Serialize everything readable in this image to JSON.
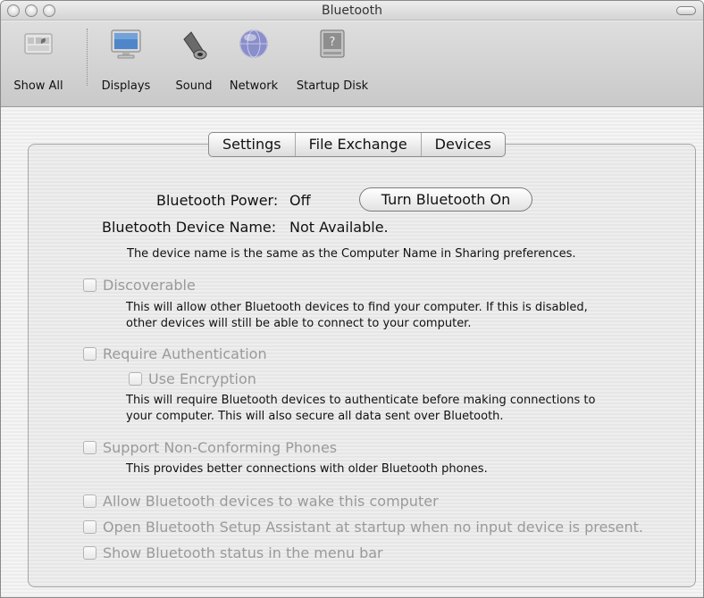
{
  "window": {
    "title": "Bluetooth"
  },
  "toolbar": {
    "items": [
      {
        "label": "Show All",
        "icon": "show-all-icon"
      },
      {
        "label": "Displays",
        "icon": "displays-icon"
      },
      {
        "label": "Sound",
        "icon": "sound-icon"
      },
      {
        "label": "Network",
        "icon": "network-icon"
      },
      {
        "label": "Startup Disk",
        "icon": "startup-disk-icon"
      }
    ]
  },
  "tabs": [
    "Settings",
    "File Exchange",
    "Devices"
  ],
  "settings": {
    "power_label": "Bluetooth Power:",
    "power_value": "Off",
    "power_button": "Turn Bluetooth On",
    "device_name_label": "Bluetooth Device Name:",
    "device_name_value": "Not Available.",
    "device_name_note": "The device name is the same as the Computer Name in Sharing preferences.",
    "discoverable": {
      "label": "Discoverable",
      "desc_line1": "This will allow other Bluetooth devices to find your computer.  If this is disabled,",
      "desc_line2": "other devices will still be able to connect to your computer."
    },
    "require_auth": {
      "label": "Require Authentication",
      "encryption": "Use Encryption",
      "desc_line1": "This will require Bluetooth devices to authenticate before making connections to",
      "desc_line2": "your computer. This will also secure all data sent over Bluetooth."
    },
    "non_conforming": {
      "label": "Support Non-Conforming Phones",
      "desc": "This provides better connections with older Bluetooth phones."
    },
    "wake": "Allow Bluetooth devices to wake this computer",
    "setup_assistant": "Open Bluetooth Setup Assistant at startup when no input device is present.",
    "menu_bar": "Show Bluetooth status in the menu bar"
  }
}
